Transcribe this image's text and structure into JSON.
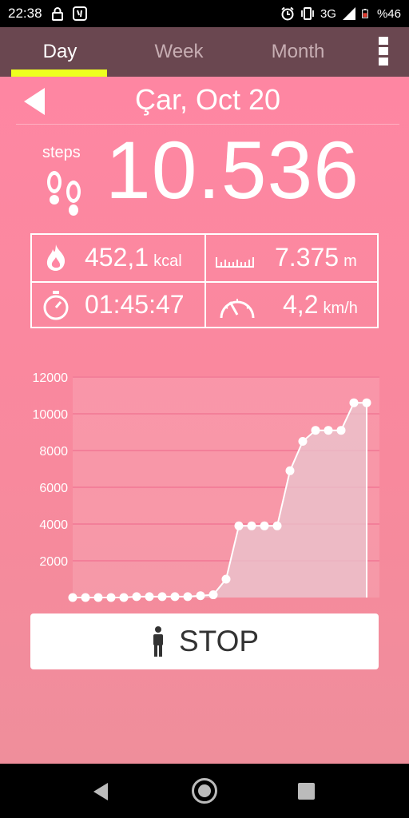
{
  "status_bar": {
    "time": "22:38",
    "network": "3G",
    "battery": "%46",
    "icons_left": [
      "lock-icon",
      "app-notification-icon"
    ],
    "icons_right": [
      "alarm-icon",
      "vibrate-icon",
      "signal-icon",
      "battery-icon"
    ]
  },
  "tabs": [
    {
      "label": "Day",
      "active": true
    },
    {
      "label": "Week",
      "active": false
    },
    {
      "label": "Month",
      "active": false
    }
  ],
  "date": "Çar, Oct 20",
  "steps": {
    "label": "steps",
    "value": "10.536"
  },
  "stats": {
    "calories": {
      "value": "452,1",
      "unit": "kcal",
      "icon": "flame-icon"
    },
    "distance": {
      "value": "7.375",
      "unit": "m",
      "icon": "ruler-icon"
    },
    "duration": {
      "value": "01:45:47",
      "icon": "stopwatch-icon"
    },
    "speed": {
      "value": "4,2",
      "unit": "km/h",
      "icon": "speedometer-icon"
    }
  },
  "chart_data": {
    "type": "area",
    "x": [
      0,
      1,
      2,
      3,
      4,
      5,
      6,
      7,
      8,
      9,
      10,
      11,
      12,
      13,
      14,
      15,
      16,
      17,
      18,
      19,
      20,
      21,
      22,
      23
    ],
    "values": [
      0,
      0,
      0,
      0,
      0,
      50,
      50,
      50,
      50,
      50,
      100,
      150,
      1000,
      3900,
      3900,
      3900,
      3900,
      6900,
      8500,
      9100,
      9100,
      9100,
      10600,
      10600
    ],
    "xticks": [
      "2",
      "4",
      "6",
      "8",
      "10",
      "12",
      "14",
      "16",
      "18",
      "20",
      "22",
      "24"
    ],
    "yticks": [
      "2000",
      "4000",
      "6000",
      "8000",
      "10000",
      "12000"
    ],
    "xlim": [
      0,
      24
    ],
    "ylim": [
      0,
      12000
    ],
    "grid": true,
    "colors": {
      "line": "#ffffff",
      "fill": "#e9c6cf",
      "grid": "#f37f99"
    }
  },
  "stop_button": {
    "label": "STOP",
    "icon": "walking-person-icon"
  },
  "nav": {
    "back": "back-icon",
    "home": "home-icon",
    "recent": "recent-apps-icon"
  }
}
